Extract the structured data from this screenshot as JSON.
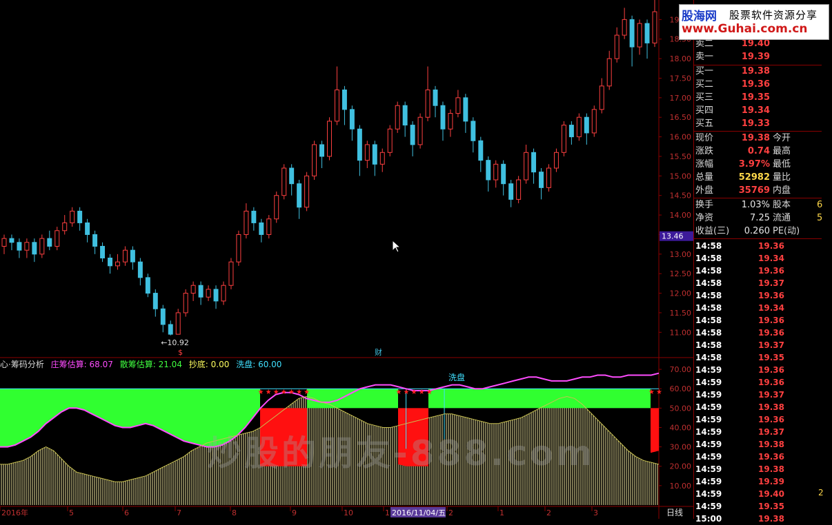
{
  "price_chart": {
    "y_ticks": [
      "19.00",
      "18.50",
      "18.00",
      "17.50",
      "17.00",
      "16.50",
      "16.00",
      "15.50",
      "15.00",
      "14.50",
      "14.00",
      "13.50",
      "13.00",
      "12.50",
      "12.00",
      "11.50",
      "11.00"
    ],
    "y_range": [
      10.6,
      19.5
    ],
    "high_label": "19.00",
    "low_label": "10.92",
    "current_price_tag": "13.46",
    "event_marker_1": "$",
    "event_marker_2": "财",
    "candles": [
      [
        0,
        13.2,
        13.4,
        13.5,
        13.0
      ],
      [
        1,
        13.4,
        13.3,
        13.5,
        13.1
      ],
      [
        2,
        13.3,
        13.1,
        13.4,
        12.9
      ],
      [
        3,
        13.1,
        13.3,
        13.4,
        12.9
      ],
      [
        4,
        13.3,
        13.0,
        13.4,
        12.8
      ],
      [
        5,
        13.0,
        13.4,
        13.5,
        12.9
      ],
      [
        6,
        13.4,
        13.2,
        13.6,
        13.1
      ],
      [
        7,
        13.2,
        13.6,
        13.7,
        13.1
      ],
      [
        8,
        13.6,
        13.8,
        14.0,
        13.5
      ],
      [
        9,
        13.8,
        14.1,
        14.2,
        13.7
      ],
      [
        10,
        14.1,
        13.8,
        14.2,
        13.6
      ],
      [
        11,
        13.8,
        13.5,
        13.9,
        13.3
      ],
      [
        12,
        13.5,
        13.2,
        13.6,
        13.0
      ],
      [
        13,
        13.2,
        12.9,
        13.3,
        12.8
      ],
      [
        14,
        12.9,
        12.7,
        13.0,
        12.5
      ],
      [
        15,
        12.7,
        12.8,
        13.0,
        12.6
      ],
      [
        16,
        12.8,
        13.1,
        13.2,
        12.7
      ],
      [
        17,
        13.1,
        12.8,
        13.2,
        12.6
      ],
      [
        18,
        12.8,
        12.4,
        12.9,
        12.2
      ],
      [
        19,
        12.4,
        12.0,
        12.5,
        11.9
      ],
      [
        20,
        12.0,
        11.6,
        12.1,
        11.4
      ],
      [
        21,
        11.6,
        11.2,
        11.7,
        11.0
      ],
      [
        22,
        11.2,
        10.95,
        11.3,
        10.92
      ],
      [
        23,
        10.95,
        11.5,
        11.6,
        10.95
      ],
      [
        24,
        11.5,
        12.0,
        12.1,
        11.4
      ],
      [
        25,
        12.0,
        12.2,
        12.3,
        11.8
      ],
      [
        26,
        12.2,
        11.9,
        12.3,
        11.7
      ],
      [
        27,
        11.9,
        12.1,
        12.2,
        11.8
      ],
      [
        28,
        12.1,
        11.8,
        12.2,
        11.6
      ],
      [
        29,
        11.8,
        12.2,
        12.3,
        11.7
      ],
      [
        30,
        12.2,
        12.8,
        12.9,
        12.1
      ],
      [
        31,
        12.8,
        13.5,
        13.6,
        12.7
      ],
      [
        32,
        13.5,
        14.1,
        14.3,
        13.4
      ],
      [
        33,
        14.1,
        13.8,
        14.2,
        13.6
      ],
      [
        34,
        13.8,
        13.5,
        13.9,
        13.3
      ],
      [
        35,
        13.5,
        13.9,
        14.0,
        13.4
      ],
      [
        36,
        13.9,
        14.5,
        14.6,
        13.8
      ],
      [
        37,
        14.5,
        15.2,
        15.3,
        14.4
      ],
      [
        38,
        15.2,
        14.8,
        15.3,
        14.5
      ],
      [
        39,
        14.8,
        14.2,
        14.9,
        13.9
      ],
      [
        40,
        14.2,
        15.0,
        15.1,
        14.1
      ],
      [
        41,
        15.0,
        15.8,
        15.9,
        14.9
      ],
      [
        42,
        15.8,
        15.5,
        15.9,
        15.2
      ],
      [
        43,
        15.5,
        16.4,
        16.5,
        15.4
      ],
      [
        44,
        16.4,
        17.2,
        17.8,
        16.3
      ],
      [
        45,
        17.2,
        16.7,
        17.3,
        16.3
      ],
      [
        46,
        16.7,
        16.2,
        16.8,
        15.9
      ],
      [
        47,
        16.2,
        15.4,
        16.3,
        15.0
      ],
      [
        48,
        15.4,
        15.8,
        15.9,
        15.2
      ],
      [
        49,
        15.8,
        15.3,
        15.9,
        15.0
      ],
      [
        50,
        15.3,
        15.6,
        15.7,
        15.1
      ],
      [
        51,
        15.6,
        16.2,
        16.3,
        15.5
      ],
      [
        52,
        16.2,
        16.8,
        16.9,
        16.1
      ],
      [
        53,
        16.8,
        16.3,
        16.9,
        16.0
      ],
      [
        54,
        16.3,
        15.8,
        16.4,
        15.5
      ],
      [
        55,
        15.8,
        16.5,
        16.6,
        15.7
      ],
      [
        56,
        16.5,
        17.2,
        17.8,
        16.4
      ],
      [
        57,
        17.2,
        16.8,
        17.3,
        16.5
      ],
      [
        58,
        16.8,
        16.2,
        16.9,
        15.9
      ],
      [
        59,
        16.2,
        16.6,
        16.7,
        16.0
      ],
      [
        60,
        16.6,
        17.0,
        17.2,
        16.5
      ],
      [
        61,
        17.0,
        16.4,
        17.1,
        16.1
      ],
      [
        62,
        16.4,
        15.9,
        16.5,
        15.6
      ],
      [
        63,
        15.9,
        15.4,
        16.0,
        15.1
      ],
      [
        64,
        15.4,
        14.9,
        15.5,
        14.6
      ],
      [
        65,
        14.9,
        15.3,
        15.4,
        14.7
      ],
      [
        66,
        15.3,
        14.8,
        15.4,
        14.5
      ],
      [
        67,
        14.8,
        14.4,
        14.9,
        14.2
      ],
      [
        68,
        14.4,
        14.9,
        15.0,
        14.3
      ],
      [
        69,
        14.9,
        15.6,
        15.8,
        14.8
      ],
      [
        70,
        15.6,
        15.1,
        15.7,
        14.8
      ],
      [
        71,
        15.1,
        14.7,
        15.2,
        14.4
      ],
      [
        72,
        14.7,
        15.2,
        15.3,
        14.6
      ],
      [
        73,
        15.2,
        15.6,
        15.7,
        15.1
      ],
      [
        74,
        15.6,
        16.3,
        16.4,
        15.5
      ],
      [
        75,
        16.3,
        16.0,
        16.4,
        15.8
      ],
      [
        76,
        16.0,
        16.5,
        16.6,
        15.9
      ],
      [
        77,
        16.5,
        16.1,
        16.6,
        15.8
      ],
      [
        78,
        16.1,
        16.7,
        16.8,
        16.0
      ],
      [
        79,
        16.7,
        17.3,
        17.5,
        16.6
      ],
      [
        80,
        17.3,
        18.0,
        18.2,
        17.2
      ],
      [
        81,
        18.0,
        18.6,
        18.8,
        17.9
      ],
      [
        82,
        18.6,
        19.0,
        19.3,
        18.5
      ],
      [
        83,
        19.0,
        18.3,
        19.1,
        17.8
      ],
      [
        84,
        18.3,
        18.9,
        19.0,
        18.1
      ],
      [
        85,
        18.9,
        18.4,
        19.0,
        18.0
      ],
      [
        86,
        18.4,
        19.2,
        19.5,
        18.3
      ]
    ]
  },
  "indicator": {
    "title": "心·筹码分析",
    "legend": [
      {
        "label": "庄筹估算:",
        "value": "68.07",
        "color": "#ff4cff"
      },
      {
        "label": "散筹估算:",
        "value": "21.04",
        "color": "#40ff40"
      },
      {
        "label": "抄底:",
        "value": "0.00",
        "color": "#ffff60"
      },
      {
        "label": "洗盘:",
        "value": "60.00",
        "color": "#40e0ff"
      }
    ],
    "annotation": "洗盘",
    "y_ticks": [
      "70.00",
      "60.00",
      "50.00",
      "40.00",
      "30.00",
      "20.00",
      "10.00"
    ],
    "y_range": [
      0,
      75
    ],
    "zhuang_series": [
      30,
      30,
      31,
      33,
      35,
      38,
      42,
      45,
      48,
      50,
      50,
      49,
      47,
      45,
      43,
      41,
      40,
      40,
      41,
      42,
      41,
      39,
      37,
      35,
      33,
      32,
      31,
      30,
      30,
      31,
      33,
      36,
      40,
      45,
      50,
      54,
      57,
      58,
      58,
      57,
      55,
      54,
      53,
      53,
      54,
      56,
      58,
      60,
      61,
      62,
      62,
      62,
      61,
      60,
      59,
      59,
      59,
      60,
      61,
      62,
      62,
      61,
      60,
      60,
      61,
      62,
      63,
      64,
      65,
      66,
      66,
      65,
      64,
      64,
      64,
      65,
      66,
      66,
      67,
      67,
      66,
      66,
      67,
      67,
      67,
      67,
      68
    ],
    "sanchou_series": [
      21,
      21,
      22,
      23,
      25,
      28,
      30,
      28,
      24,
      20,
      17,
      16,
      15,
      14,
      13,
      12,
      12,
      13,
      14,
      15,
      17,
      19,
      21,
      23,
      25,
      28,
      30,
      32,
      33,
      34,
      35,
      36,
      37,
      38,
      40,
      43,
      46,
      49,
      52,
      55,
      56,
      55,
      53,
      52,
      50,
      48,
      46,
      44,
      42,
      41,
      40,
      40,
      41,
      42,
      43,
      44,
      45,
      46,
      47,
      47,
      46,
      45,
      44,
      43,
      42,
      42,
      43,
      44,
      45,
      47,
      49,
      51,
      53,
      55,
      56,
      55,
      52,
      48,
      44,
      40,
      36,
      32,
      28,
      25,
      23,
      22,
      21
    ],
    "xipan_level": 60,
    "buy_zones": [
      [
        34,
        40
      ],
      [
        52,
        56
      ],
      [
        85,
        94
      ]
    ],
    "wash_dips": [
      [
        53,
        49
      ],
      [
        58,
        54
      ]
    ]
  },
  "x_axis": {
    "labels": [
      "2016年",
      "5",
      "6",
      "7",
      "8",
      "9",
      "10",
      "1",
      "2",
      "1",
      "2",
      "3"
    ],
    "cursor_date": "2016/11/04/五",
    "period_label": "日线"
  },
  "quote": {
    "sell_rows": [
      {
        "label": "卖二",
        "value": "19.40"
      },
      {
        "label": "卖一",
        "value": "19.39"
      }
    ],
    "buy_rows": [
      {
        "label": "买一",
        "value": "19.38"
      },
      {
        "label": "买二",
        "value": "19.36"
      },
      {
        "label": "买三",
        "value": "19.35"
      },
      {
        "label": "买四",
        "value": "19.34"
      },
      {
        "label": "买五",
        "value": "19.33"
      }
    ],
    "stats": [
      {
        "label": "现价",
        "value": "19.38",
        "label2": "今开",
        "value2": ""
      },
      {
        "label": "涨跌",
        "value": "0.74",
        "label2": "最高",
        "value2": ""
      },
      {
        "label": "涨幅",
        "value": "3.97%",
        "label2": "最低",
        "value2": ""
      },
      {
        "label": "总量",
        "value": "52982",
        "label2": "量比",
        "value2": ""
      },
      {
        "label": "外盘",
        "value": "35769",
        "label2": "内盘",
        "value2": ""
      }
    ],
    "fundamentals": [
      {
        "label": "换手",
        "value": "1.03%",
        "label2": "股本",
        "value2": "6"
      },
      {
        "label": "净资",
        "value": "7.25",
        "label2": "流通",
        "value2": "5"
      },
      {
        "label": "收益(三)",
        "value": "0.260",
        "label2": "PE(动)",
        "value2": ""
      }
    ],
    "ticks": [
      {
        "time": "14:58",
        "price": "19.36"
      },
      {
        "time": "14:58",
        "price": "19.34"
      },
      {
        "time": "14:58",
        "price": "19.36"
      },
      {
        "time": "14:58",
        "price": "19.37"
      },
      {
        "time": "14:58",
        "price": "19.36"
      },
      {
        "time": "14:58",
        "price": "19.34"
      },
      {
        "time": "14:58",
        "price": "19.36"
      },
      {
        "time": "14:58",
        "price": "19.36"
      },
      {
        "time": "14:58",
        "price": "19.37"
      },
      {
        "time": "14:58",
        "price": "19.35"
      },
      {
        "time": "14:59",
        "price": "19.36"
      },
      {
        "time": "14:59",
        "price": "19.36"
      },
      {
        "time": "14:59",
        "price": "19.37"
      },
      {
        "time": "14:59",
        "price": "19.38"
      },
      {
        "time": "14:59",
        "price": "19.36"
      },
      {
        "time": "14:59",
        "price": "19.37"
      },
      {
        "time": "14:59",
        "price": "19.38"
      },
      {
        "time": "14:59",
        "price": "19.36"
      },
      {
        "time": "14:59",
        "price": "19.38"
      },
      {
        "time": "14:59",
        "price": "19.39"
      },
      {
        "time": "14:59",
        "price": "19.40"
      },
      {
        "time": "14:59",
        "price": "19.35"
      },
      {
        "time": "15:00",
        "price": "19.38"
      }
    ],
    "tick_side_value": "2"
  },
  "logo": {
    "brand": "股海网",
    "tagline": "股票软件资源分享",
    "url": "www.Guhai.com.cn"
  },
  "watermark": "炒股的朋友-888.com",
  "colors": {
    "up": "#ff4040",
    "down": "#40c0e0",
    "grid": "#8b0000",
    "axis_text": "#c03030"
  }
}
